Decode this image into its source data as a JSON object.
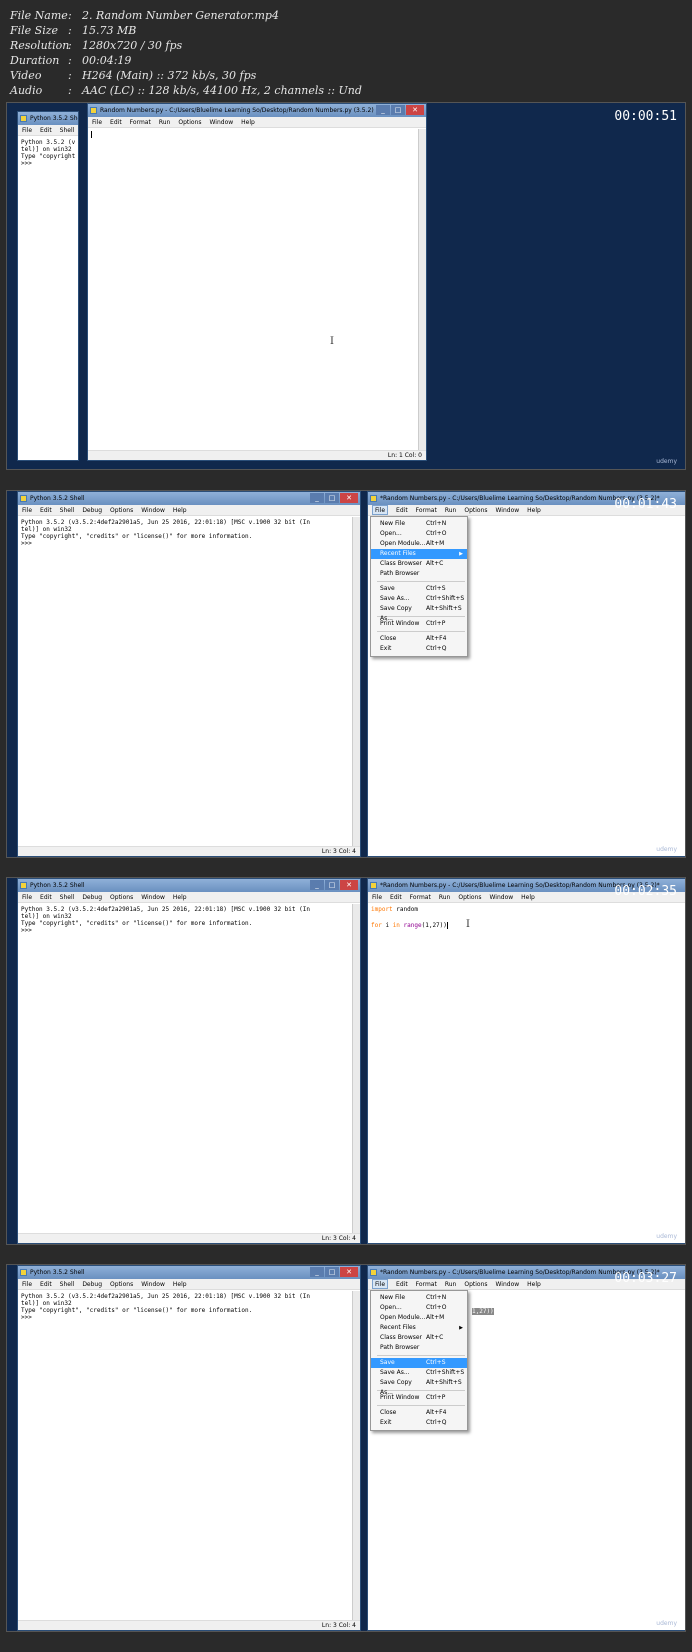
{
  "file_info": [
    {
      "key": "File Name",
      "value": "2. Random Number Generator.mp4"
    },
    {
      "key": "File Size",
      "value": "15.73 MB"
    },
    {
      "key": "Resolution",
      "value": "1280x720 / 30 fps"
    },
    {
      "key": "Duration",
      "value": "00:04:19"
    },
    {
      "key": "Video",
      "value": "H264 (Main) :: 372 kb/s, 30 fps"
    },
    {
      "key": "Audio",
      "value": "AAC (LC) :: 128 kb/s, 44100 Hz, 2 channels :: Und"
    }
  ],
  "udemy_label": "udemy",
  "shell": {
    "title": "Python 3.5.2 Shell",
    "menu": [
      "File",
      "Edit",
      "Shell",
      "Debug",
      "Options",
      "Window",
      "Help"
    ],
    "text_full": "Python 3.5.2 (v3.5.2:4def2a2901a5, Jun 25 2016, 22:01:18) [MSC v.1900 32 bit (In\ntel)] on win32\nType \"copyright\", \"credits\" or \"license()\" for more information.\n>>> ",
    "text_clipped": "Python 3.5.2 (v\ntel)] on win32\nType \"copyright\n>>> ",
    "status": "Ln: 3   Col: 4"
  },
  "editor": {
    "title_clean": "Random Numbers.py - C:/Users/Bluelime Learning So/Desktop/Random Numbers.py (3.5.2)",
    "title_modified": "*Random Numbers.py - C:/Users/Bluelime Learning So/Desktop/Random Numbers.py (3.5.2)*",
    "menu": [
      "File",
      "Edit",
      "Format",
      "Run",
      "Options",
      "Window",
      "Help"
    ],
    "status_f1": "Ln: 1   Col: 0",
    "code_line1_kw": "import",
    "code_line1_rest": " random",
    "code_line2_kw1": "for",
    "code_line2_mid": " i ",
    "code_line2_kw2": "in",
    "code_line2_sp": " ",
    "code_line2_bi": "range",
    "code_line2_rest": "(1,27))",
    "selected_fragment": "1,27))"
  },
  "file_menu": {
    "items": [
      {
        "label": "New File",
        "accel": "Ctrl+N"
      },
      {
        "label": "Open...",
        "accel": "Ctrl+O"
      },
      {
        "label": "Open Module...",
        "accel": "Alt+M"
      },
      {
        "label": "Recent Files",
        "accel": ""
      },
      {
        "label": "Class Browser",
        "accel": "Alt+C"
      },
      {
        "label": "Path Browser",
        "accel": ""
      },
      {
        "label": "Save",
        "accel": "Ctrl+S"
      },
      {
        "label": "Save As...",
        "accel": "Ctrl+Shift+S"
      },
      {
        "label": "Save Copy As...",
        "accel": "Alt+Shift+S"
      },
      {
        "label": "Print Window",
        "accel": "Ctrl+P"
      },
      {
        "label": "Close",
        "accel": "Alt+F4"
      },
      {
        "label": "Exit",
        "accel": "Ctrl+Q"
      }
    ]
  },
  "frames": [
    {
      "timestamp": "00:00:51"
    },
    {
      "timestamp": "00:01:43"
    },
    {
      "timestamp": "00:02:35"
    },
    {
      "timestamp": "00:03:27"
    }
  ]
}
